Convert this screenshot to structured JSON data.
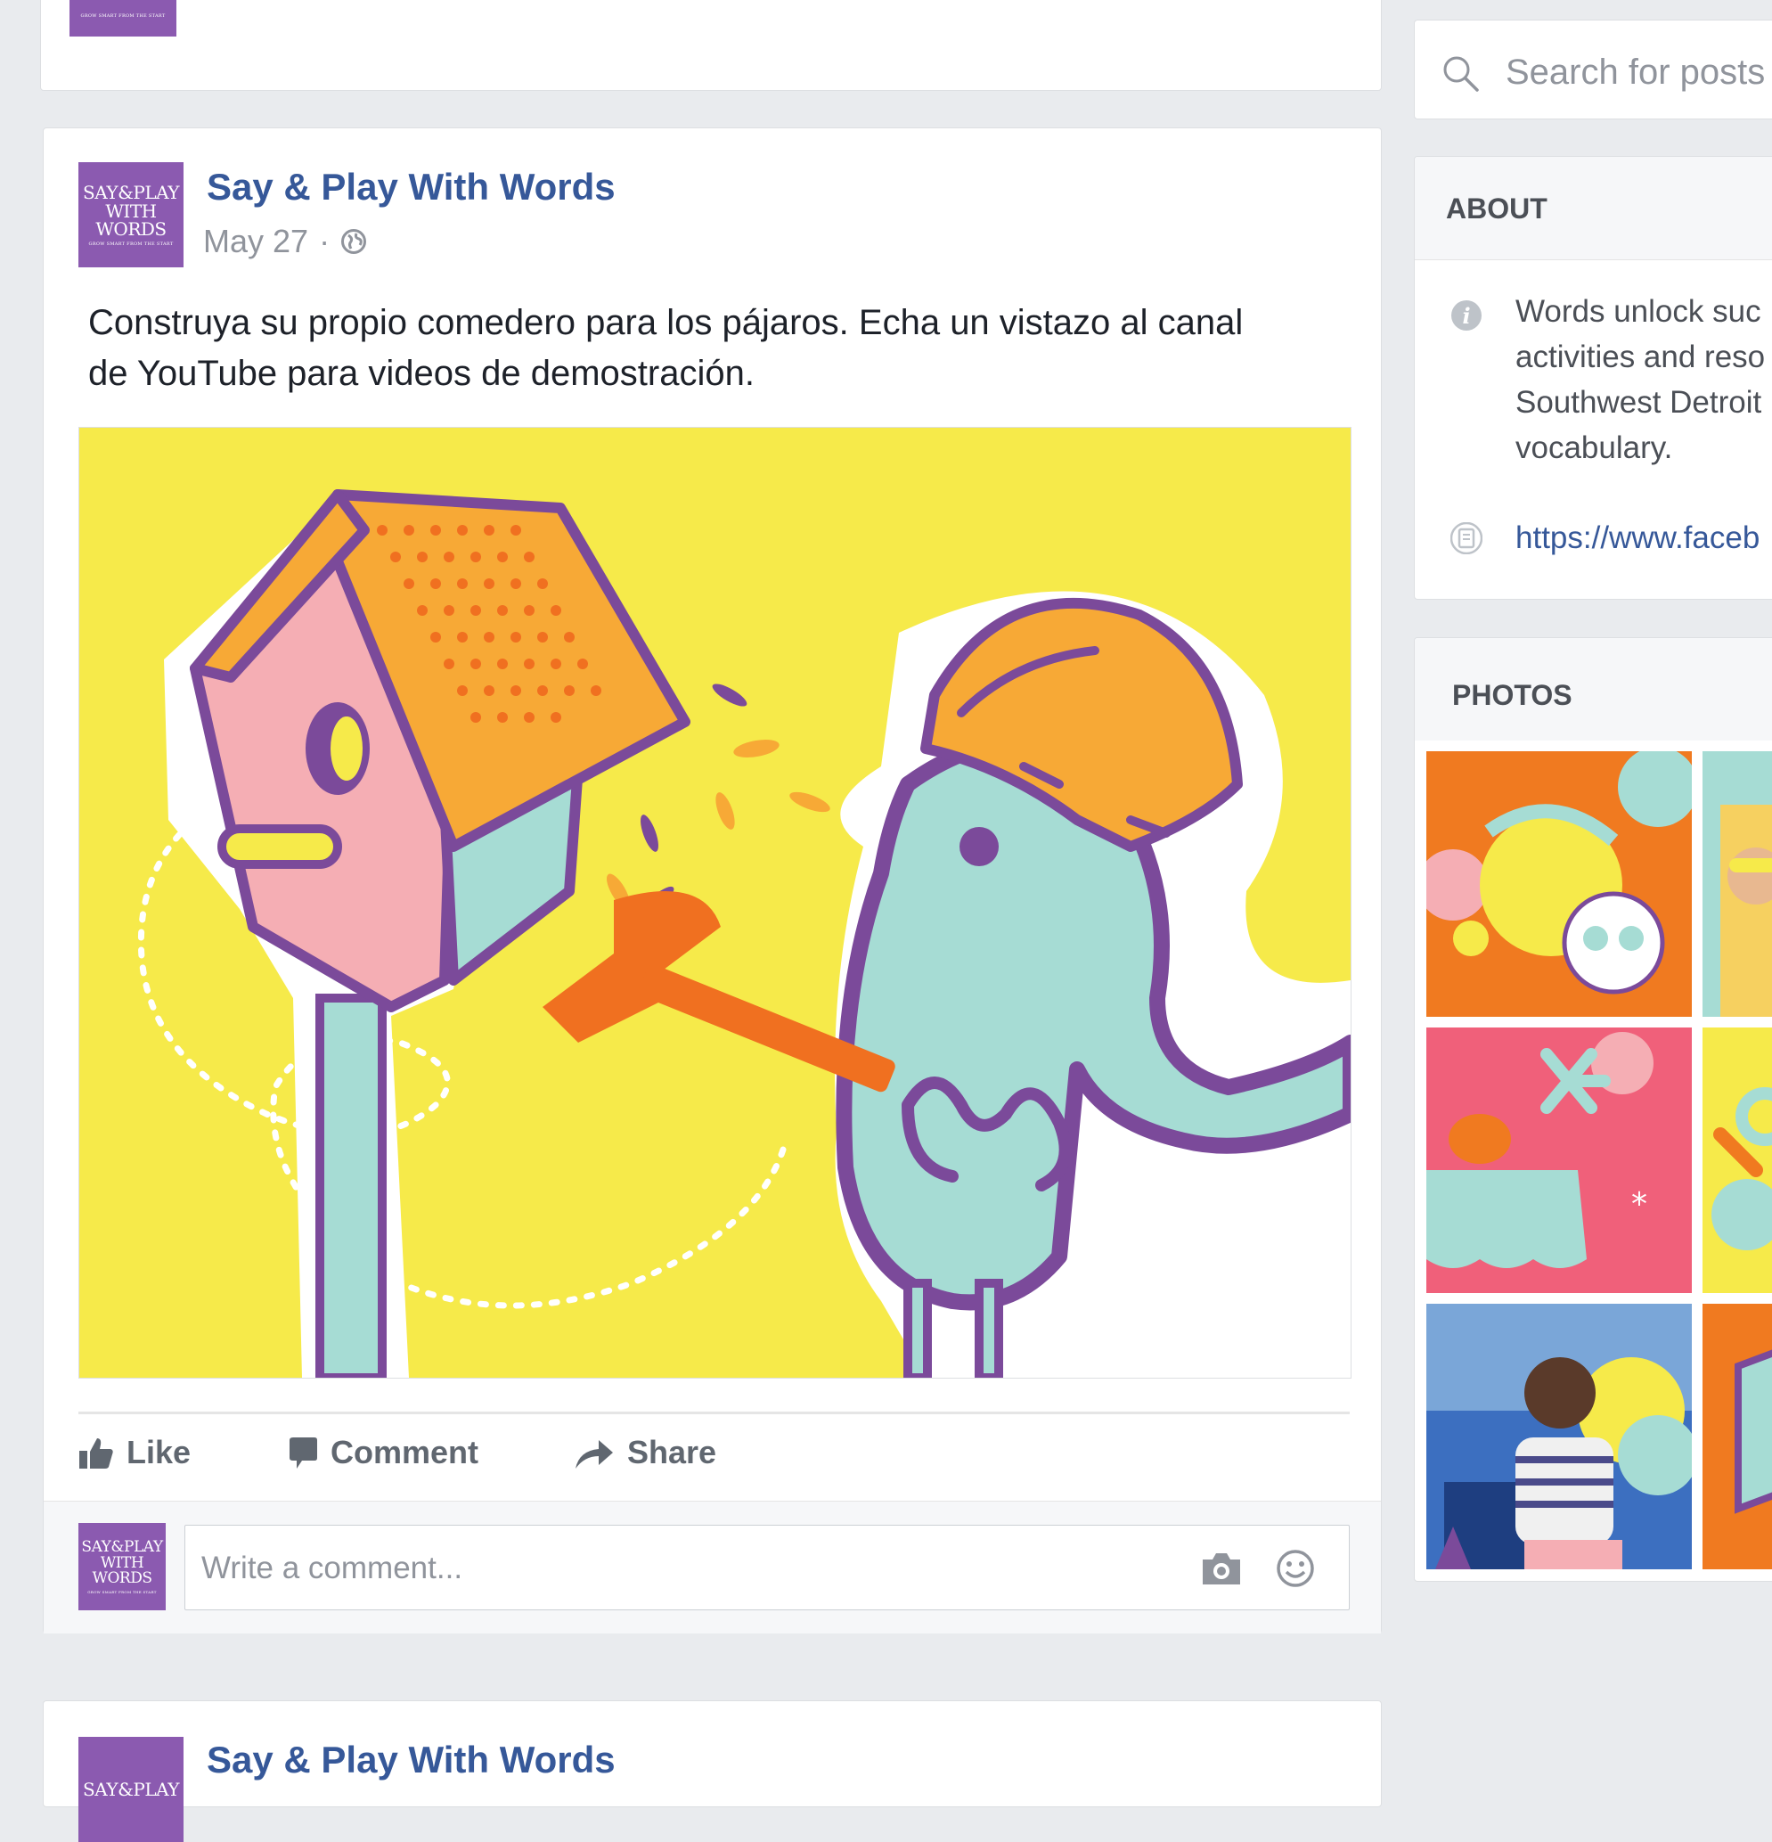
{
  "post": {
    "page_name": "Say & Play With Words",
    "date": "May 27",
    "separator": "·",
    "text_line1": "Construya su propio comedero para los pájaros. Echa un vistazo al canal",
    "text_line2": "de YouTube para videos de demostración.",
    "actions": {
      "like": "Like",
      "comment": "Comment",
      "share": "Share"
    },
    "comment_placeholder": "Write a comment..."
  },
  "logo": {
    "line1": "SAY&PLAY",
    "line2": "WITH WORDS",
    "tagline": "GROW SMART FROM THE START"
  },
  "next_post": {
    "page_name": "Say & Play With Words"
  },
  "sidebar": {
    "search_placeholder": "Search for posts",
    "about": {
      "heading": "ABOUT",
      "lines": [
        "Words unlock suc",
        "activities and reso",
        "Southwest Detroit",
        "vocabulary."
      ],
      "link": "https://www.faceb"
    },
    "photos": {
      "heading": "PHOTOS"
    }
  },
  "colors": {
    "link_blue": "#365899",
    "brand_purple": "#8b5ab0",
    "background": "#e9ebee"
  }
}
